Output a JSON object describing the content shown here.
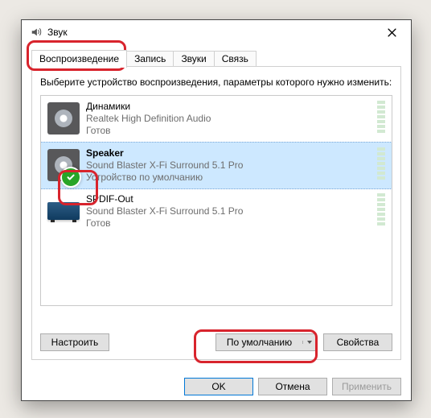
{
  "title": "Звук",
  "tabs": [
    "Воспроизведение",
    "Запись",
    "Звуки",
    "Связь"
  ],
  "activeTab": 0,
  "instruction": "Выберите устройство воспроизведения, параметры которого нужно изменить:",
  "devices": [
    {
      "name": "Динамики",
      "sub": "Realtek High Definition Audio",
      "status": "Готов",
      "icon": "speaker",
      "selected": false,
      "default": false
    },
    {
      "name": "Speaker",
      "sub": "Sound Blaster X-Fi Surround 5.1 Pro",
      "status": "Устройство по умолчанию",
      "icon": "speaker",
      "selected": true,
      "default": true
    },
    {
      "name": "SPDIF-Out",
      "sub": "Sound Blaster X-Fi Surround 5.1 Pro",
      "status": "Готов",
      "icon": "amp",
      "selected": false,
      "default": false
    }
  ],
  "buttons": {
    "configure": "Настроить",
    "setDefault": "По умолчанию",
    "properties": "Свойства",
    "ok": "OK",
    "cancel": "Отмена",
    "apply": "Применить"
  }
}
